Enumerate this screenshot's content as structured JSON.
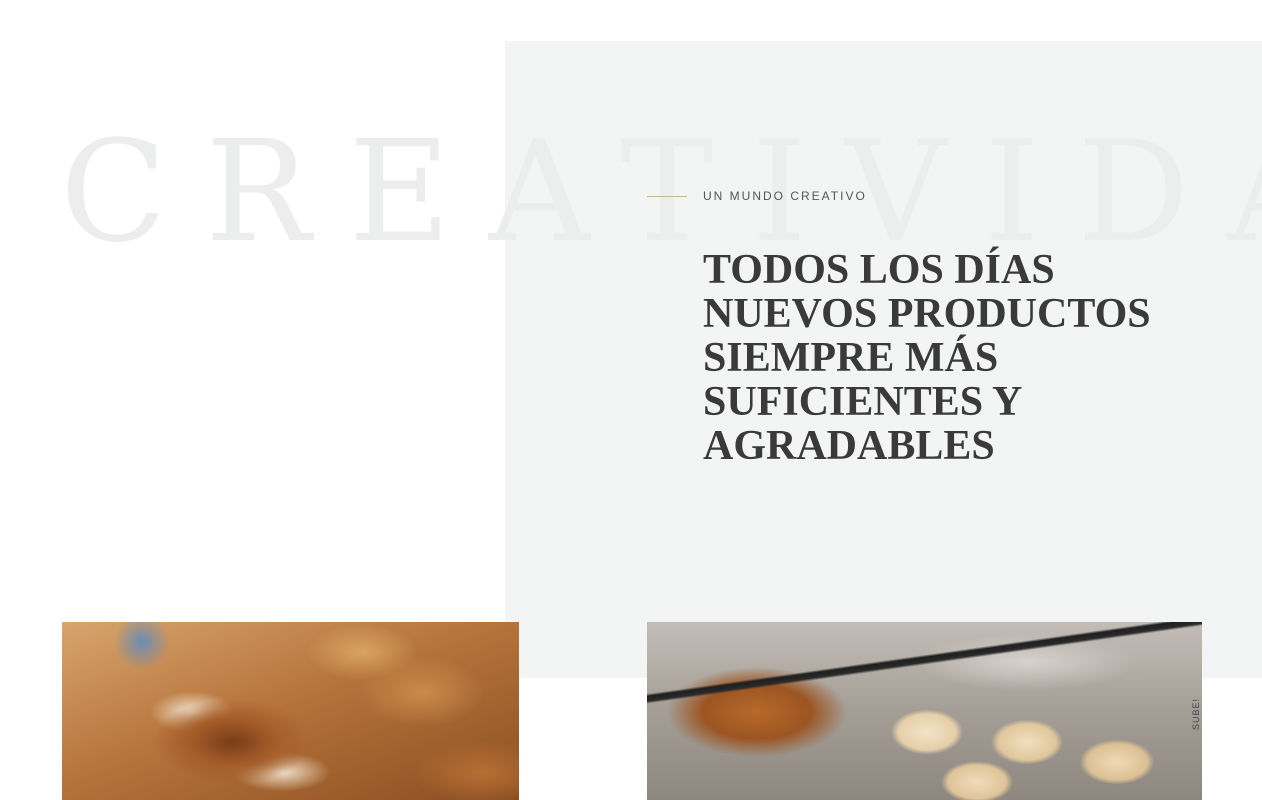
{
  "background_word": "CREATIVIDAD",
  "intro": {
    "eyebrow": "UN MUNDO CREATIVO",
    "headline_lines": [
      "TODOS LOS DÍAS",
      "NUEVOS PRODUCTOS",
      "SIEMPRE MÁS",
      "SUFICIENTES Y",
      "AGRADABLES"
    ]
  },
  "scroll_top": {
    "label": "SUBE!"
  },
  "colors": {
    "panel_background": "#f3f5f4",
    "headline": "#3a3a3a",
    "eyebrow_line": "#c8b89a",
    "background_word": "#eceeed"
  }
}
